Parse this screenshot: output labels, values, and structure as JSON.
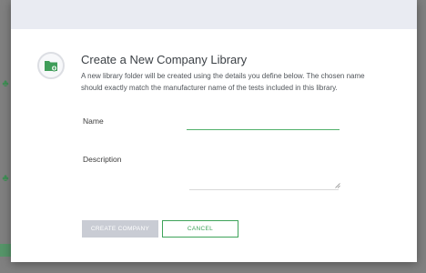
{
  "dialog": {
    "title": "Create a New Company Library",
    "description": "A new library folder will be created using the details you define below. The chosen name should exactly match the manufacturer name of the tests included in this library."
  },
  "form": {
    "name_label": "Name",
    "name_value": "",
    "description_label": "Description",
    "description_value": ""
  },
  "buttons": {
    "create": "CREATE COMPANY",
    "cancel": "CANCEL"
  },
  "icons": {
    "dialog_icon": "folder-plus-icon",
    "background_icons": [
      "tree-icon",
      "tree-icon",
      "tree-icon"
    ]
  },
  "colors": {
    "accent": "#3ea35a",
    "disabled_button": "#c9ccd4",
    "overlay": "#808080",
    "header_band": "#e9ebf2"
  }
}
